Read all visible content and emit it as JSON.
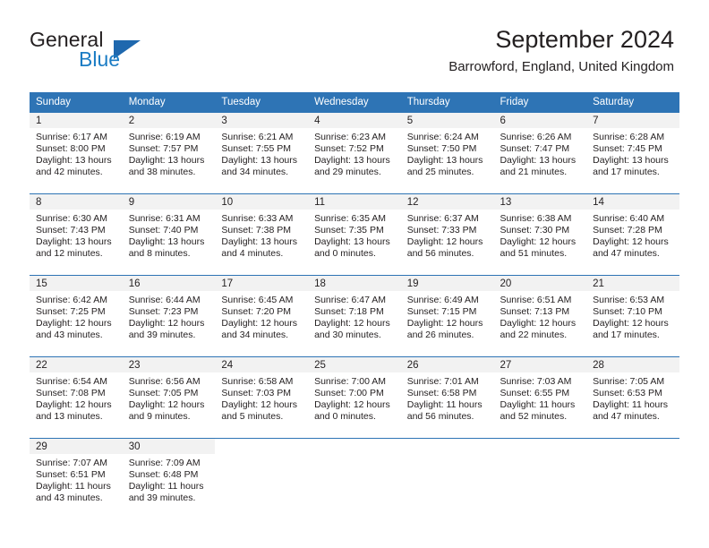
{
  "brand": {
    "word1": "General",
    "word2": "Blue",
    "triangle_color": "#1f68ae",
    "blue_text_color": "#1b7cc4"
  },
  "header": {
    "title": "September 2024",
    "subtitle": "Barrowford, England, United Kingdom",
    "header_bg": "#2e74b5",
    "daynum_bg": "#f2f2f2"
  },
  "weekday_headers": [
    "Sunday",
    "Monday",
    "Tuesday",
    "Wednesday",
    "Thursday",
    "Friday",
    "Saturday"
  ],
  "labels": {
    "sunrise_prefix": "Sunrise:",
    "sunset_prefix": "Sunset:",
    "daylight_prefix": "Daylight:"
  },
  "weeks": [
    [
      {
        "day": "1",
        "sunrise": "Sunrise: 6:17 AM",
        "sunset": "Sunset: 8:00 PM",
        "daylight1": "Daylight: 13 hours",
        "daylight2": "and 42 minutes."
      },
      {
        "day": "2",
        "sunrise": "Sunrise: 6:19 AM",
        "sunset": "Sunset: 7:57 PM",
        "daylight1": "Daylight: 13 hours",
        "daylight2": "and 38 minutes."
      },
      {
        "day": "3",
        "sunrise": "Sunrise: 6:21 AM",
        "sunset": "Sunset: 7:55 PM",
        "daylight1": "Daylight: 13 hours",
        "daylight2": "and 34 minutes."
      },
      {
        "day": "4",
        "sunrise": "Sunrise: 6:23 AM",
        "sunset": "Sunset: 7:52 PM",
        "daylight1": "Daylight: 13 hours",
        "daylight2": "and 29 minutes."
      },
      {
        "day": "5",
        "sunrise": "Sunrise: 6:24 AM",
        "sunset": "Sunset: 7:50 PM",
        "daylight1": "Daylight: 13 hours",
        "daylight2": "and 25 minutes."
      },
      {
        "day": "6",
        "sunrise": "Sunrise: 6:26 AM",
        "sunset": "Sunset: 7:47 PM",
        "daylight1": "Daylight: 13 hours",
        "daylight2": "and 21 minutes."
      },
      {
        "day": "7",
        "sunrise": "Sunrise: 6:28 AM",
        "sunset": "Sunset: 7:45 PM",
        "daylight1": "Daylight: 13 hours",
        "daylight2": "and 17 minutes."
      }
    ],
    [
      {
        "day": "8",
        "sunrise": "Sunrise: 6:30 AM",
        "sunset": "Sunset: 7:43 PM",
        "daylight1": "Daylight: 13 hours",
        "daylight2": "and 12 minutes."
      },
      {
        "day": "9",
        "sunrise": "Sunrise: 6:31 AM",
        "sunset": "Sunset: 7:40 PM",
        "daylight1": "Daylight: 13 hours",
        "daylight2": "and 8 minutes."
      },
      {
        "day": "10",
        "sunrise": "Sunrise: 6:33 AM",
        "sunset": "Sunset: 7:38 PM",
        "daylight1": "Daylight: 13 hours",
        "daylight2": "and 4 minutes."
      },
      {
        "day": "11",
        "sunrise": "Sunrise: 6:35 AM",
        "sunset": "Sunset: 7:35 PM",
        "daylight1": "Daylight: 13 hours",
        "daylight2": "and 0 minutes."
      },
      {
        "day": "12",
        "sunrise": "Sunrise: 6:37 AM",
        "sunset": "Sunset: 7:33 PM",
        "daylight1": "Daylight: 12 hours",
        "daylight2": "and 56 minutes."
      },
      {
        "day": "13",
        "sunrise": "Sunrise: 6:38 AM",
        "sunset": "Sunset: 7:30 PM",
        "daylight1": "Daylight: 12 hours",
        "daylight2": "and 51 minutes."
      },
      {
        "day": "14",
        "sunrise": "Sunrise: 6:40 AM",
        "sunset": "Sunset: 7:28 PM",
        "daylight1": "Daylight: 12 hours",
        "daylight2": "and 47 minutes."
      }
    ],
    [
      {
        "day": "15",
        "sunrise": "Sunrise: 6:42 AM",
        "sunset": "Sunset: 7:25 PM",
        "daylight1": "Daylight: 12 hours",
        "daylight2": "and 43 minutes."
      },
      {
        "day": "16",
        "sunrise": "Sunrise: 6:44 AM",
        "sunset": "Sunset: 7:23 PM",
        "daylight1": "Daylight: 12 hours",
        "daylight2": "and 39 minutes."
      },
      {
        "day": "17",
        "sunrise": "Sunrise: 6:45 AM",
        "sunset": "Sunset: 7:20 PM",
        "daylight1": "Daylight: 12 hours",
        "daylight2": "and 34 minutes."
      },
      {
        "day": "18",
        "sunrise": "Sunrise: 6:47 AM",
        "sunset": "Sunset: 7:18 PM",
        "daylight1": "Daylight: 12 hours",
        "daylight2": "and 30 minutes."
      },
      {
        "day": "19",
        "sunrise": "Sunrise: 6:49 AM",
        "sunset": "Sunset: 7:15 PM",
        "daylight1": "Daylight: 12 hours",
        "daylight2": "and 26 minutes."
      },
      {
        "day": "20",
        "sunrise": "Sunrise: 6:51 AM",
        "sunset": "Sunset: 7:13 PM",
        "daylight1": "Daylight: 12 hours",
        "daylight2": "and 22 minutes."
      },
      {
        "day": "21",
        "sunrise": "Sunrise: 6:53 AM",
        "sunset": "Sunset: 7:10 PM",
        "daylight1": "Daylight: 12 hours",
        "daylight2": "and 17 minutes."
      }
    ],
    [
      {
        "day": "22",
        "sunrise": "Sunrise: 6:54 AM",
        "sunset": "Sunset: 7:08 PM",
        "daylight1": "Daylight: 12 hours",
        "daylight2": "and 13 minutes."
      },
      {
        "day": "23",
        "sunrise": "Sunrise: 6:56 AM",
        "sunset": "Sunset: 7:05 PM",
        "daylight1": "Daylight: 12 hours",
        "daylight2": "and 9 minutes."
      },
      {
        "day": "24",
        "sunrise": "Sunrise: 6:58 AM",
        "sunset": "Sunset: 7:03 PM",
        "daylight1": "Daylight: 12 hours",
        "daylight2": "and 5 minutes."
      },
      {
        "day": "25",
        "sunrise": "Sunrise: 7:00 AM",
        "sunset": "Sunset: 7:00 PM",
        "daylight1": "Daylight: 12 hours",
        "daylight2": "and 0 minutes."
      },
      {
        "day": "26",
        "sunrise": "Sunrise: 7:01 AM",
        "sunset": "Sunset: 6:58 PM",
        "daylight1": "Daylight: 11 hours",
        "daylight2": "and 56 minutes."
      },
      {
        "day": "27",
        "sunrise": "Sunrise: 7:03 AM",
        "sunset": "Sunset: 6:55 PM",
        "daylight1": "Daylight: 11 hours",
        "daylight2": "and 52 minutes."
      },
      {
        "day": "28",
        "sunrise": "Sunrise: 7:05 AM",
        "sunset": "Sunset: 6:53 PM",
        "daylight1": "Daylight: 11 hours",
        "daylight2": "and 47 minutes."
      }
    ],
    [
      {
        "day": "29",
        "sunrise": "Sunrise: 7:07 AM",
        "sunset": "Sunset: 6:51 PM",
        "daylight1": "Daylight: 11 hours",
        "daylight2": "and 43 minutes."
      },
      {
        "day": "30",
        "sunrise": "Sunrise: 7:09 AM",
        "sunset": "Sunset: 6:48 PM",
        "daylight1": "Daylight: 11 hours",
        "daylight2": "and 39 minutes."
      },
      {
        "day": "",
        "sunrise": "",
        "sunset": "",
        "daylight1": "",
        "daylight2": ""
      },
      {
        "day": "",
        "sunrise": "",
        "sunset": "",
        "daylight1": "",
        "daylight2": ""
      },
      {
        "day": "",
        "sunrise": "",
        "sunset": "",
        "daylight1": "",
        "daylight2": ""
      },
      {
        "day": "",
        "sunrise": "",
        "sunset": "",
        "daylight1": "",
        "daylight2": ""
      },
      {
        "day": "",
        "sunrise": "",
        "sunset": "",
        "daylight1": "",
        "daylight2": ""
      }
    ]
  ]
}
